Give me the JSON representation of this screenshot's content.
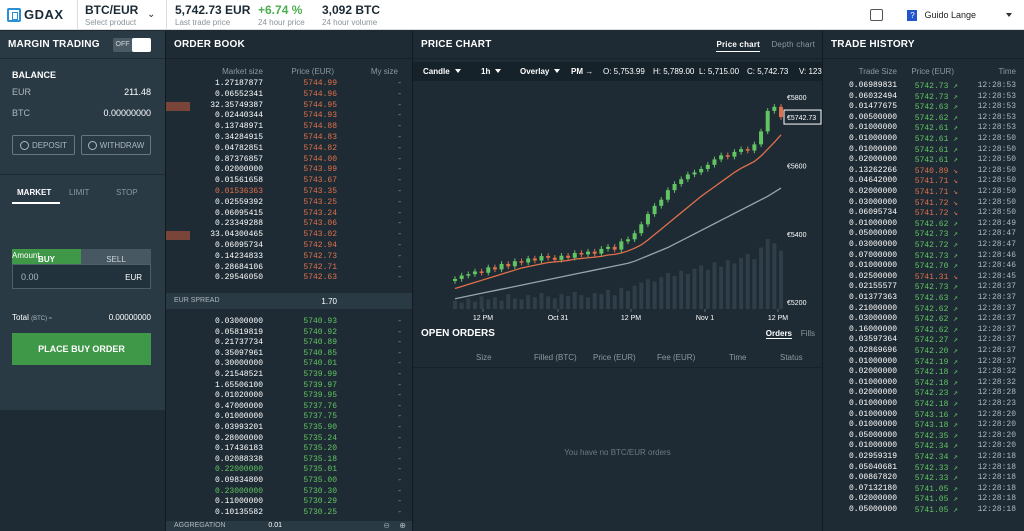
{
  "topbar": {
    "logo": "GDAX",
    "pair": "BTC/EUR",
    "pair_sub": "Select product",
    "last_price": "5,742.73 EUR",
    "last_price_sub": "Last trade price",
    "change": "+6.74 %",
    "change_sub": "24 hour price",
    "volume": "3,092 BTC",
    "volume_sub": "24 hour volume",
    "user_name": "Guido Lange",
    "help_label": "?"
  },
  "left": {
    "title": "MARGIN TRADING",
    "toggle_label": "OFF",
    "balance_title": "BALANCE",
    "eur_label": "EUR",
    "eur_value": "211.48",
    "btc_label": "BTC",
    "btc_value": "0.00000000",
    "deposit": "DEPOSIT",
    "withdraw": "WITHDRAW",
    "tabs": [
      "MARKET",
      "LIMIT",
      "STOP"
    ],
    "buy": "BUY",
    "sell": "SELL",
    "amount_label": "Amount",
    "amount_value": "0.00",
    "amount_unit": "EUR",
    "total_label": "Total",
    "total_unit": "(BTC) ≈",
    "total_value": "0.00000000",
    "place": "PLACE BUY ORDER"
  },
  "orderbook": {
    "title": "ORDER BOOK",
    "col_size": "Market size",
    "col_price": "Price (EUR)",
    "col_my": "My size",
    "asks": [
      [
        "1.27187877",
        "5744.99"
      ],
      [
        "0.06552341",
        "5744.96"
      ],
      [
        "32.35749387",
        "5744.95"
      ],
      [
        "0.02440344",
        "5744.93"
      ],
      [
        "0.13748971",
        "5744.88"
      ],
      [
        "0.34284915",
        "5744.83"
      ],
      [
        "0.04782851",
        "5744.82"
      ],
      [
        "0.87376857",
        "5744.00"
      ],
      [
        "0.02000000",
        "5743.99"
      ],
      [
        "0.01561658",
        "5743.67"
      ],
      [
        "0.01536363",
        "5743.35"
      ],
      [
        "0.02559392",
        "5743.25"
      ],
      [
        "0.06095415",
        "5743.24"
      ],
      [
        "0.23349288",
        "5743.06"
      ],
      [
        "33.04300465",
        "5743.02"
      ],
      [
        "0.06095734",
        "5742.94"
      ],
      [
        "0.14234833",
        "5742.73"
      ],
      [
        "0.28684106",
        "5742.71"
      ],
      [
        "0.29546050",
        "5742.63"
      ]
    ],
    "ask_highlight_index": 10,
    "spread_label": "EUR SPREAD",
    "spread_value": "1.70",
    "bids": [
      [
        "0.03000000",
        "5740.93"
      ],
      [
        "0.05819819",
        "5740.92"
      ],
      [
        "0.21737734",
        "5740.89"
      ],
      [
        "0.35097961",
        "5740.85"
      ],
      [
        "0.30000000",
        "5740.01"
      ],
      [
        "0.21548521",
        "5739.99"
      ],
      [
        "1.65506100",
        "5739.97"
      ],
      [
        "0.01020000",
        "5739.95"
      ],
      [
        "0.47000000",
        "5737.76"
      ],
      [
        "0.01000000",
        "5737.75"
      ],
      [
        "0.03993201",
        "5735.90"
      ],
      [
        "0.28000000",
        "5735.24"
      ],
      [
        "0.17436183",
        "5735.20"
      ],
      [
        "0.02088338",
        "5735.18"
      ],
      [
        "0.22000000",
        "5735.01"
      ],
      [
        "0.09834800",
        "5735.00"
      ],
      [
        "0.23000000",
        "5730.30"
      ],
      [
        "0.11000000",
        "5730.29"
      ],
      [
        "0.10135582",
        "5730.25"
      ]
    ],
    "bid_highlight_indices": [
      14,
      16
    ],
    "aggregation_label": "AGGREGATION",
    "aggregation_value": "0.01"
  },
  "chart": {
    "title": "PRICE CHART",
    "tab_price": "Price chart",
    "tab_depth": "Depth chart",
    "candle": "Candle",
    "interval": "1h",
    "overlay": "Overlay",
    "ohlc_pm": "PM →",
    "ohlc_o": "O: 5,753.99",
    "ohlc_h": "H: 5,789.00",
    "ohlc_l": "L: 5,715.00",
    "ohlc_c": "C: 5,742.73",
    "ohlc_v": "V: 123",
    "current_price_label": "€5742.73",
    "y_ticks": [
      "€5800",
      "€5600",
      "€5400",
      "€5200"
    ],
    "x_ticks": [
      "12 PM",
      "Oct 31",
      "12 PM",
      "Nov 1",
      "12 PM"
    ]
  },
  "chart_data": {
    "type": "line",
    "title": "",
    "xlabel": "",
    "ylabel": "",
    "ylim": [
      5180,
      5830
    ],
    "x": [
      1,
      2,
      3,
      4,
      5,
      6,
      7,
      8,
      9,
      10,
      11,
      12,
      13,
      14,
      15,
      16,
      17,
      18,
      19,
      20,
      21,
      22,
      23,
      24,
      25,
      26,
      27,
      28,
      29,
      30,
      31,
      32,
      33,
      34,
      35,
      36,
      37,
      38,
      39,
      40,
      41,
      42,
      43,
      44,
      45,
      46,
      47,
      48,
      49,
      50
    ],
    "series": [
      {
        "values": [
          5268,
          5278,
          5282,
          5290,
          5286,
          5302,
          5296,
          5312,
          5305,
          5320,
          5316,
          5328,
          5322,
          5335,
          5330,
          5324,
          5336,
          5330,
          5344,
          5340,
          5348,
          5342,
          5356,
          5362,
          5354,
          5378,
          5384,
          5402,
          5428,
          5458,
          5482,
          5500,
          5528,
          5546,
          5560,
          5574,
          5580,
          5590,
          5602,
          5618,
          5630,
          5626,
          5640,
          5648,
          5644,
          5662,
          5700,
          5760,
          5772,
          5742
        ]
      },
      {
        "values": [
          5240,
          5246,
          5252,
          5258,
          5264,
          5270,
          5276,
          5282,
          5288,
          5294,
          5300,
          5304,
          5308,
          5312,
          5316,
          5318,
          5320,
          5322,
          5326,
          5328,
          5330,
          5332,
          5334,
          5338,
          5340,
          5344,
          5350,
          5358,
          5368,
          5382,
          5398,
          5414,
          5430,
          5446,
          5462,
          5478,
          5494,
          5510,
          5524,
          5538,
          5552,
          5566,
          5580,
          5592,
          5602,
          5612,
          5628,
          5648,
          5668,
          5690
        ]
      },
      {
        "values": [
          5210,
          5214,
          5218,
          5222,
          5226,
          5230,
          5234,
          5238,
          5242,
          5246,
          5250,
          5254,
          5258,
          5262,
          5266,
          5270,
          5274,
          5278,
          5282,
          5286,
          5290,
          5294,
          5298,
          5302,
          5306,
          5310,
          5314,
          5320,
          5328,
          5336,
          5344,
          5352,
          5360,
          5370,
          5380,
          5390,
          5400,
          5410,
          5420,
          5430,
          5440,
          5450,
          5460,
          5470,
          5480,
          5490,
          5500,
          5510,
          5522,
          5534
        ]
      }
    ],
    "volume": [
      8,
      6,
      10,
      7,
      12,
      9,
      11,
      8,
      14,
      10,
      9,
      13,
      11,
      15,
      12,
      10,
      14,
      12,
      16,
      13,
      11,
      15,
      14,
      18,
      13,
      20,
      17,
      22,
      25,
      28,
      26,
      30,
      34,
      31,
      36,
      33,
      38,
      41,
      37,
      44,
      40,
      46,
      43,
      48,
      52,
      47,
      58,
      66,
      62,
      55
    ]
  },
  "open_orders": {
    "title": "OPEN ORDERS",
    "tab_orders": "Orders",
    "tab_fills": "Fills",
    "cols": [
      "Size",
      "Filled (BTC)",
      "Price (EUR)",
      "Fee (EUR)",
      "Time",
      "Status"
    ],
    "empty": "You have no BTC/EUR orders"
  },
  "trade_history": {
    "title": "TRADE HISTORY",
    "col_size": "Trade Size",
    "col_price": "Price (EUR)",
    "col_time": "Time",
    "rows": [
      [
        "0.06989831",
        "5742.73",
        "up",
        "12:28:53"
      ],
      [
        "0.06032494",
        "5742.73",
        "up",
        "12:28:53"
      ],
      [
        "0.01477675",
        "5742.63",
        "up",
        "12:28:53"
      ],
      [
        "0.00500000",
        "5742.62",
        "up",
        "12:28:53"
      ],
      [
        "0.01000000",
        "5742.61",
        "up",
        "12:28:53"
      ],
      [
        "0.01000000",
        "5742.61",
        "up",
        "12:28:50"
      ],
      [
        "0.01000000",
        "5742.61",
        "up",
        "12:28:50"
      ],
      [
        "0.02000000",
        "5742.61",
        "up",
        "12:28:50"
      ],
      [
        "0.13262266",
        "5740.89",
        "dn",
        "12:28:50"
      ],
      [
        "0.04642000",
        "5741.71",
        "dn",
        "12:28:50"
      ],
      [
        "0.02000000",
        "5741.71",
        "dn",
        "12:28:50"
      ],
      [
        "0.03000000",
        "5741.72",
        "dn",
        "12:28:50"
      ],
      [
        "0.06095734",
        "5741.72",
        "dn",
        "12:28:50"
      ],
      [
        "0.01000000",
        "5742.62",
        "up",
        "12:28:49"
      ],
      [
        "0.05000000",
        "5742.73",
        "up",
        "12:28:47"
      ],
      [
        "0.03000000",
        "5742.72",
        "up",
        "12:28:47"
      ],
      [
        "0.07000000",
        "5742.73",
        "up",
        "12:28:46"
      ],
      [
        "0.01000000",
        "5742.70",
        "up",
        "12:28:46"
      ],
      [
        "0.02500000",
        "5741.31",
        "dn",
        "12:28:45"
      ],
      [
        "0.02155577",
        "5742.73",
        "up",
        "12:28:37"
      ],
      [
        "0.01377363",
        "5742.63",
        "up",
        "12:28:37"
      ],
      [
        "0.21000000",
        "5742.62",
        "up",
        "12:28:37"
      ],
      [
        "0.03000000",
        "5742.62",
        "up",
        "12:28:37"
      ],
      [
        "0.16000000",
        "5742.62",
        "up",
        "12:28:37"
      ],
      [
        "0.03597364",
        "5742.27",
        "up",
        "12:28:37"
      ],
      [
        "0.02869696",
        "5742.20",
        "up",
        "12:28:37"
      ],
      [
        "0.01000000",
        "5742.19",
        "up",
        "12:28:37"
      ],
      [
        "0.02000000",
        "5742.18",
        "up",
        "12:28:32"
      ],
      [
        "0.01000000",
        "5742.18",
        "up",
        "12:28:32"
      ],
      [
        "0.02000000",
        "5742.23",
        "up",
        "12:28:28"
      ],
      [
        "0.01000000",
        "5742.18",
        "up",
        "12:28:23"
      ],
      [
        "0.01000000",
        "5743.16",
        "up",
        "12:28:20"
      ],
      [
        "0.01000000",
        "5743.18",
        "up",
        "12:28:20"
      ],
      [
        "0.05000000",
        "5742.35",
        "up",
        "12:28:20"
      ],
      [
        "0.01000000",
        "5742.34",
        "up",
        "12:28:20"
      ],
      [
        "0.02959319",
        "5742.34",
        "up",
        "12:28:18"
      ],
      [
        "0.05040681",
        "5742.33",
        "up",
        "12:28:18"
      ],
      [
        "0.00867820",
        "5742.33",
        "up",
        "12:28:18"
      ],
      [
        "0.07132180",
        "5741.05",
        "up",
        "12:28:18"
      ],
      [
        "0.02000000",
        "5741.05",
        "up",
        "12:28:18"
      ],
      [
        "0.05000000",
        "5741.05",
        "up",
        "12:28:18"
      ]
    ]
  },
  "colors": {
    "up": "#62c462",
    "down": "#e0704a",
    "accent": "#3f9848",
    "panel": "#1e2b34"
  }
}
